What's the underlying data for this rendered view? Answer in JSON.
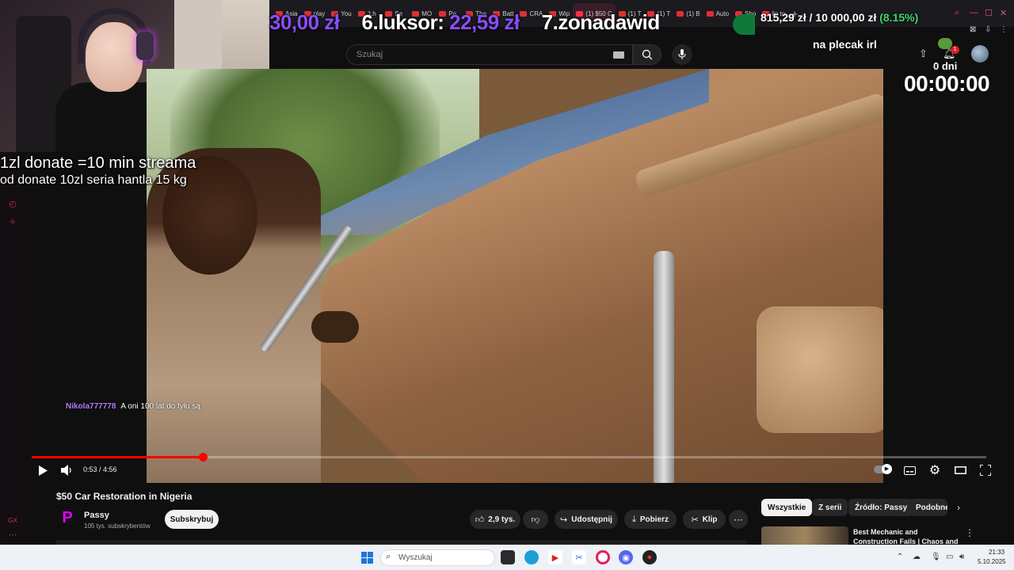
{
  "browser": {
    "tabs": [
      {
        "label": "Asia",
        "active": false
      },
      {
        "label": "play",
        "active": false
      },
      {
        "label": "You",
        "active": false
      },
      {
        "label": "'Lh",
        "active": false
      },
      {
        "label": "Se",
        "active": false
      },
      {
        "label": "MO",
        "active": false
      },
      {
        "label": "Pe",
        "active": false
      },
      {
        "label": "The",
        "active": false
      },
      {
        "label": "Batt",
        "active": false
      },
      {
        "label": "CRA",
        "active": false
      },
      {
        "label": "Wip",
        "active": false
      },
      {
        "label": "(1) $50 C",
        "active": true
      },
      {
        "label": "(1) T",
        "active": false
      },
      {
        "label": "(1) T",
        "active": false
      },
      {
        "label": "(1) B",
        "active": false
      },
      {
        "label": "Auto",
        "active": false
      },
      {
        "label": "Sho",
        "active": false
      },
      {
        "label": "ile to",
        "active": false
      }
    ]
  },
  "stream_overlay": {
    "ticker": [
      {
        "value": "30,00 zł"
      },
      {
        "rank": "6.",
        "name": "luksor:",
        "value": "22,59 zł"
      },
      {
        "rank": "7.",
        "name": "zonadawid",
        "value": ""
      }
    ],
    "donation_current": "815,29 zł",
    "donation_goal": "/ 10 000,00 zł",
    "donation_percent": "(8.15%)",
    "goal_label": "na plecak irl",
    "days_label": "0 dni",
    "timer": "00:00:00",
    "cam_text_line1": "1zl donate =10 min streama",
    "cam_text_line2": "od donate 10zl seria hantla 15 kg",
    "chat": {
      "user": "Nikola777778",
      "message": "A oni 100 lat do tyłu są"
    }
  },
  "youtube": {
    "search_placeholder": "Szukaj",
    "notification_count": "1",
    "player": {
      "time": "0:53 / 4:56",
      "progress": 0.1791
    },
    "video_title": "$50 Car Restoration in Nigeria",
    "channel_initial": "P",
    "channel_name": "Passy",
    "subscribers": "105 tys. subskrybentów",
    "subscribe_label": "Subskrybuj",
    "actions": {
      "likes": "2,9 tys.",
      "share": "Udostępnij",
      "download": "Pobierz",
      "clip": "Klip"
    },
    "chips": [
      "Wszystkie",
      "Z serii",
      "Źródło: Passy",
      "Podobne"
    ],
    "recommendation_title": "Best Mechanic and Construction Fails | Chaos and"
  },
  "taskbar": {
    "search_placeholder": "Wyszukaj",
    "time": "21:33",
    "date": "5.10.2025"
  },
  "colors": {
    "accent_red": "#ff0000",
    "ticker_purple": "#8a4dff",
    "percent_green": "#3fd56b",
    "chat_user": "#b57cff"
  }
}
